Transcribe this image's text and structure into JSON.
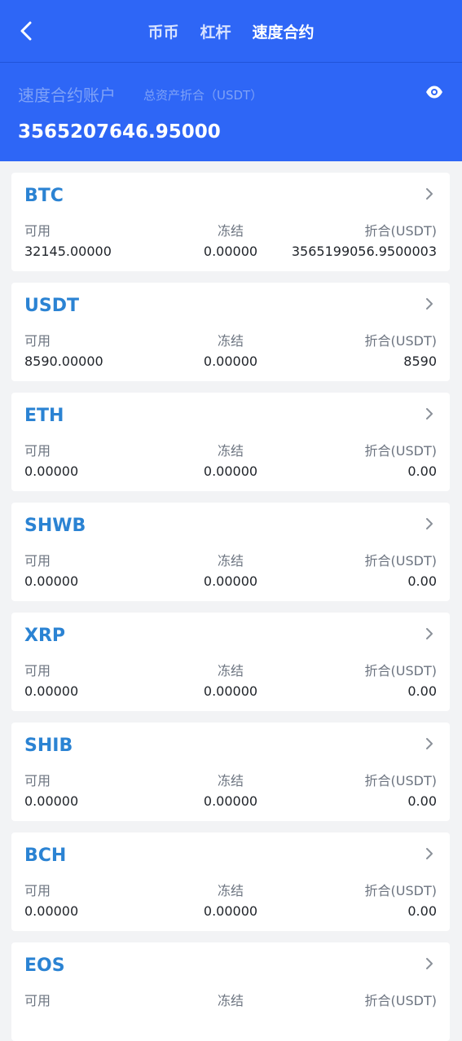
{
  "nav": {
    "tabs": [
      "币币",
      "杠杆",
      "速度合约"
    ],
    "active_tab": 2
  },
  "account": {
    "title": "速度合约账户",
    "subtitle": "总资产折合（USDT）",
    "total": "3565207646.95000"
  },
  "labels": {
    "available": "可用",
    "frozen": "冻结",
    "converted": "折合(USDT)"
  },
  "assets": [
    {
      "coin": "BTC",
      "available": "32145.00000",
      "frozen": "0.00000",
      "converted": "3565199056.9500003"
    },
    {
      "coin": "USDT",
      "available": "8590.00000",
      "frozen": "0.00000",
      "converted": "8590"
    },
    {
      "coin": "ETH",
      "available": "0.00000",
      "frozen": "0.00000",
      "converted": "0.00"
    },
    {
      "coin": "SHWB",
      "available": "0.00000",
      "frozen": "0.00000",
      "converted": "0.00"
    },
    {
      "coin": "XRP",
      "available": "0.00000",
      "frozen": "0.00000",
      "converted": "0.00"
    },
    {
      "coin": "SHIB",
      "available": "0.00000",
      "frozen": "0.00000",
      "converted": "0.00"
    },
    {
      "coin": "BCH",
      "available": "0.00000",
      "frozen": "0.00000",
      "converted": "0.00"
    },
    {
      "coin": "EOS",
      "available": "",
      "frozen": "",
      "converted": ""
    }
  ],
  "colors": {
    "header_bg": "#2e66f6",
    "coin_text": "#2b83d3",
    "page_bg": "#f2f3f5"
  },
  "icons": {
    "back": "chevron-left-icon",
    "visibility": "eye-icon",
    "row_arrow": "chevron-right-icon"
  }
}
